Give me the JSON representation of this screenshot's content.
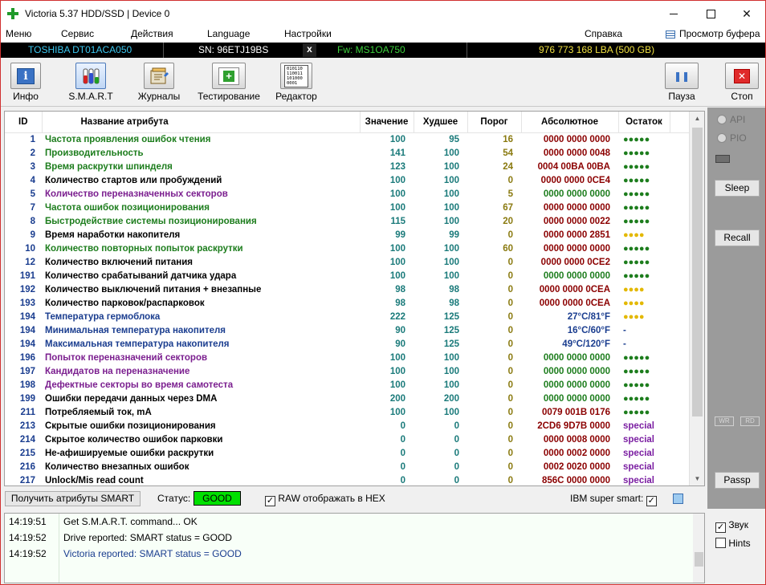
{
  "window": {
    "title": "Victoria 5.37 HDD/SSD | Device 0",
    "close_glyph": "✕"
  },
  "menu": {
    "items": [
      "Меню",
      "Сервис",
      "Действия",
      "Language",
      "Настройки"
    ],
    "help": "Справка",
    "buffer": "Просмотр буфера"
  },
  "drive": {
    "model": "TOSHIBA DT01ACA050",
    "serial": "SN: 96ETJ19BS",
    "close_glyph": "x",
    "firmware": "Fw: MS1OA750",
    "capacity": "976 773 168 LBA (500 GB)"
  },
  "toolbar": {
    "info": "Инфо",
    "smart": "S.M.A.R.T",
    "logs": "Журналы",
    "testing": "Тестирование",
    "editor": "Редактор",
    "pause": "Пауза",
    "stop": "Стоп",
    "info_glyph": "i",
    "testing_glyph": "+",
    "editor_glyph": "010110\n110011\n101000\n0001",
    "pause_glyph": "❚❚",
    "stop_glyph": "✕"
  },
  "table": {
    "headers": {
      "id": "ID",
      "name": "Название атрибута",
      "value": "Значение",
      "worst": "Худшее",
      "threshold": "Порог",
      "raw": "Абсолютное",
      "remain": "Остаток"
    },
    "rows": [
      {
        "id": "1",
        "name": "Частота проявления ошибок чтения",
        "name_color": "#1d7d1d",
        "value": "100",
        "worst": "95",
        "thr": "16",
        "raw": "0000 0000 0000",
        "raw_color": "#8b0000",
        "rem": "●●●●●",
        "rem_type": "green"
      },
      {
        "id": "2",
        "name": "Производительность",
        "name_color": "#1d7d1d",
        "value": "141",
        "worst": "100",
        "thr": "54",
        "raw": "0000 0000 0048",
        "raw_color": "#8b0000",
        "rem": "●●●●●",
        "rem_type": "green"
      },
      {
        "id": "3",
        "name": "Время раскрутки шпинделя",
        "name_color": "#1d7d1d",
        "value": "123",
        "worst": "100",
        "thr": "24",
        "raw": "0004 00BA 00BA",
        "raw_color": "#8b0000",
        "rem": "●●●●●",
        "rem_type": "green"
      },
      {
        "id": "4",
        "name": "Количество стартов или пробуждений",
        "name_color": "#000000",
        "value": "100",
        "worst": "100",
        "thr": "0",
        "raw": "0000 0000 0CE4",
        "raw_color": "#8b0000",
        "rem": "●●●●●",
        "rem_type": "green"
      },
      {
        "id": "5",
        "name": "Количество переназначенных секторов",
        "name_color": "#7b1f8f",
        "value": "100",
        "worst": "100",
        "thr": "5",
        "raw": "0000 0000 0000",
        "raw_color": "#1d7d1d",
        "rem": "●●●●●",
        "rem_type": "green"
      },
      {
        "id": "7",
        "name": "Частота ошибок позиционирования",
        "name_color": "#1d7d1d",
        "value": "100",
        "worst": "100",
        "thr": "67",
        "raw": "0000 0000 0000",
        "raw_color": "#8b0000",
        "rem": "●●●●●",
        "rem_type": "green"
      },
      {
        "id": "8",
        "name": "Быстродействие системы позиционирования",
        "name_color": "#1d7d1d",
        "value": "115",
        "worst": "100",
        "thr": "20",
        "raw": "0000 0000 0022",
        "raw_color": "#8b0000",
        "rem": "●●●●●",
        "rem_type": "green"
      },
      {
        "id": "9",
        "name": "Время наработки накопителя",
        "name_color": "#000000",
        "value": "99",
        "worst": "99",
        "thr": "0",
        "raw": "0000 0000 2851",
        "raw_color": "#8b0000",
        "rem": "●●●●",
        "rem_type": "yellow"
      },
      {
        "id": "10",
        "name": "Количество повторных попыток раскрутки",
        "name_color": "#1d7d1d",
        "value": "100",
        "worst": "100",
        "thr": "60",
        "raw": "0000 0000 0000",
        "raw_color": "#8b0000",
        "rem": "●●●●●",
        "rem_type": "green"
      },
      {
        "id": "12",
        "name": "Количество включений питания",
        "name_color": "#000000",
        "value": "100",
        "worst": "100",
        "thr": "0",
        "raw": "0000 0000 0CE2",
        "raw_color": "#8b0000",
        "rem": "●●●●●",
        "rem_type": "green"
      },
      {
        "id": "191",
        "name": "Количество срабатываний датчика удара",
        "name_color": "#000000",
        "value": "100",
        "worst": "100",
        "thr": "0",
        "raw": "0000 0000 0000",
        "raw_color": "#1d7d1d",
        "rem": "●●●●●",
        "rem_type": "green"
      },
      {
        "id": "192",
        "name": "Количество выключений питания + внезапные",
        "name_color": "#000000",
        "value": "98",
        "worst": "98",
        "thr": "0",
        "raw": "0000 0000 0CEA",
        "raw_color": "#8b0000",
        "rem": "●●●●",
        "rem_type": "yellow"
      },
      {
        "id": "193",
        "name": "Количество парковок/распарковок",
        "name_color": "#000000",
        "value": "98",
        "worst": "98",
        "thr": "0",
        "raw": "0000 0000 0CEA",
        "raw_color": "#8b0000",
        "rem": "●●●●",
        "rem_type": "yellow"
      },
      {
        "id": "194",
        "name": "Температура гермоблока",
        "name_color": "#1a3d8f",
        "value": "222",
        "worst": "125",
        "thr": "0",
        "raw": "27°C/81°F",
        "raw_color": "#1a3d8f",
        "rem": "●●●●",
        "rem_type": "yellow"
      },
      {
        "id": "194",
        "name": "Минимальная температура накопителя",
        "name_color": "#1a3d8f",
        "value": "90",
        "worst": "125",
        "thr": "0",
        "raw": "16°C/60°F",
        "raw_color": "#1a3d8f",
        "rem": "-",
        "rem_type": "dash"
      },
      {
        "id": "194",
        "name": "Максимальная температура накопителя",
        "name_color": "#1a3d8f",
        "value": "90",
        "worst": "125",
        "thr": "0",
        "raw": "49°C/120°F",
        "raw_color": "#1a3d8f",
        "rem": "-",
        "rem_type": "dash"
      },
      {
        "id": "196",
        "name": "Попыток переназначений секторов",
        "name_color": "#7b1f8f",
        "value": "100",
        "worst": "100",
        "thr": "0",
        "raw": "0000 0000 0000",
        "raw_color": "#1d7d1d",
        "rem": "●●●●●",
        "rem_type": "green"
      },
      {
        "id": "197",
        "name": "Кандидатов на переназначение",
        "name_color": "#7b1f8f",
        "value": "100",
        "worst": "100",
        "thr": "0",
        "raw": "0000 0000 0000",
        "raw_color": "#1d7d1d",
        "rem": "●●●●●",
        "rem_type": "green"
      },
      {
        "id": "198",
        "name": "Дефектные секторы во время самотеста",
        "name_color": "#7b1f8f",
        "value": "100",
        "worst": "100",
        "thr": "0",
        "raw": "0000 0000 0000",
        "raw_color": "#1d7d1d",
        "rem": "●●●●●",
        "rem_type": "green"
      },
      {
        "id": "199",
        "name": "Ошибки передачи данных через DMA",
        "name_color": "#000000",
        "value": "200",
        "worst": "200",
        "thr": "0",
        "raw": "0000 0000 0000",
        "raw_color": "#1d7d1d",
        "rem": "●●●●●",
        "rem_type": "green"
      },
      {
        "id": "211",
        "name": "Потребляемый ток, mA",
        "name_color": "#000000",
        "value": "100",
        "worst": "100",
        "thr": "0",
        "raw": "0079 001B 0176",
        "raw_color": "#8b0000",
        "rem": "●●●●●",
        "rem_type": "green"
      },
      {
        "id": "213",
        "name": "Скрытые ошибки позиционирования",
        "name_color": "#000000",
        "value": "0",
        "worst": "0",
        "thr": "0",
        "raw": "2CD6 9D7B 0000",
        "raw_color": "#8b0000",
        "rem": "special",
        "rem_type": "special"
      },
      {
        "id": "214",
        "name": "Скрытое количество ошибок парковки",
        "name_color": "#000000",
        "value": "0",
        "worst": "0",
        "thr": "0",
        "raw": "0000 0008 0000",
        "raw_color": "#8b0000",
        "rem": "special",
        "rem_type": "special"
      },
      {
        "id": "215",
        "name": "Не-афишируемые ошибки раскрутки",
        "name_color": "#000000",
        "value": "0",
        "worst": "0",
        "thr": "0",
        "raw": "0000 0002 0000",
        "raw_color": "#8b0000",
        "rem": "special",
        "rem_type": "special"
      },
      {
        "id": "216",
        "name": "Количество внезапных ошибок",
        "name_color": "#000000",
        "value": "0",
        "worst": "0",
        "thr": "0",
        "raw": "0002 0020 0000",
        "raw_color": "#8b0000",
        "rem": "special",
        "rem_type": "special"
      },
      {
        "id": "217",
        "name": "Unlock/Mis read count",
        "name_color": "#000000",
        "value": "0",
        "worst": "0",
        "thr": "0",
        "raw": "856C 0000 0000",
        "raw_color": "#8b0000",
        "rem": "special",
        "rem_type": "special"
      }
    ]
  },
  "right_panel": {
    "api": "API",
    "pio": "PIO",
    "sleep": "Sleep",
    "recall": "Recall",
    "wr": "WR",
    "rd": "RD",
    "passp": "Passp"
  },
  "status": {
    "get_button": "Получить атрибуты SMART",
    "label": "Статус:",
    "value": "GOOD",
    "hex_checkbox": "RAW отображать в HEX",
    "ibm": "IBM super smart:",
    "check_glyph": "✓"
  },
  "log": [
    {
      "time": "14:19:51",
      "msg": "Get S.M.A.R.T. command... OK",
      "color": "#000000"
    },
    {
      "time": "14:19:52",
      "msg": "Drive reported: SMART status = GOOD",
      "color": "#000000"
    },
    {
      "time": "14:19:52",
      "msg": "Victoria reported: SMART status = GOOD",
      "color": "#1a3d8f"
    }
  ],
  "side_checks": {
    "sound": "Звук",
    "hints": "Hints"
  }
}
